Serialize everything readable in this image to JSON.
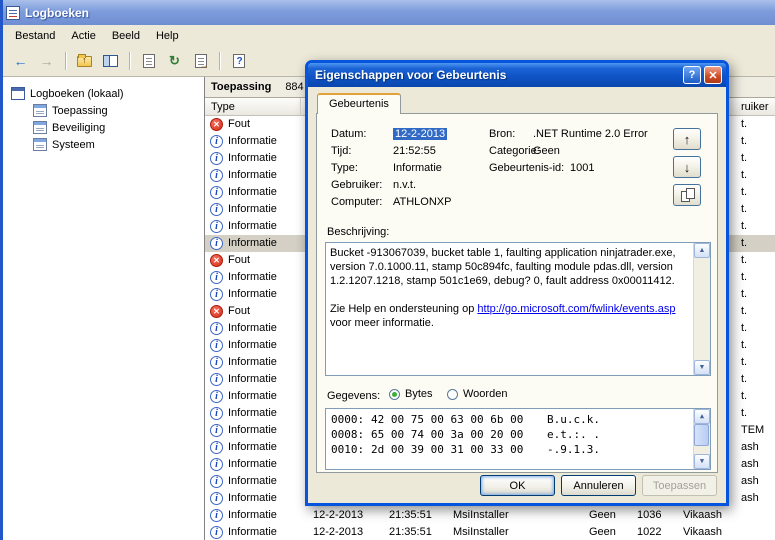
{
  "window": {
    "title": "Logboeken",
    "menus": [
      "Bestand",
      "Actie",
      "Beeld",
      "Help"
    ],
    "toolbar": [
      {
        "kind": "glyph",
        "name": "back",
        "glyph": "←",
        "cls": "c-blue"
      },
      {
        "kind": "glyph",
        "name": "forward",
        "glyph": "→",
        "cls": "c-gray"
      },
      {
        "kind": "sep"
      },
      {
        "kind": "shape",
        "name": "up-level"
      },
      {
        "kind": "shape",
        "name": "show-hide-tree"
      },
      {
        "kind": "sep"
      },
      {
        "kind": "shape",
        "name": "properties"
      },
      {
        "kind": "glyph",
        "name": "refresh",
        "glyph": "↻",
        "cls": "c-green"
      },
      {
        "kind": "shape",
        "name": "export-list"
      },
      {
        "kind": "sep"
      },
      {
        "kind": "shape",
        "name": "help"
      }
    ]
  },
  "tree": {
    "root": {
      "label": "Logboeken (lokaal)"
    },
    "items": [
      {
        "label": "Toepassing"
      },
      {
        "label": "Beveiliging"
      },
      {
        "label": "Systeem"
      }
    ]
  },
  "list": {
    "pane_title": "Toepassing",
    "pane_count": "884",
    "columns": {
      "type": "Type",
      "gebruiker_partial": "ruiker"
    },
    "icons": {
      "error_glyph": "✕",
      "info_glyph": "i"
    },
    "rows": [
      {
        "type": "Fout",
        "gebruiker_tail": "t."
      },
      {
        "type": "Informatie",
        "gebruiker_tail": "t."
      },
      {
        "type": "Informatie",
        "gebruiker_tail": "t."
      },
      {
        "type": "Informatie",
        "gebruiker_tail": "t."
      },
      {
        "type": "Informatie",
        "gebruiker_tail": "t."
      },
      {
        "type": "Informatie",
        "gebruiker_tail": "t."
      },
      {
        "type": "Informatie",
        "gebruiker_tail": "t."
      },
      {
        "type": "Informatie",
        "gebruiker_tail": "t.",
        "selected": true
      },
      {
        "type": "Fout",
        "gebruiker_tail": "t."
      },
      {
        "type": "Informatie",
        "gebruiker_tail": "t."
      },
      {
        "type": "Informatie",
        "gebruiker_tail": "t."
      },
      {
        "type": "Fout",
        "gebruiker_tail": "t."
      },
      {
        "type": "Informatie",
        "gebruiker_tail": "t."
      },
      {
        "type": "Informatie",
        "gebruiker_tail": "t."
      },
      {
        "type": "Informatie",
        "gebruiker_tail": "t."
      },
      {
        "type": "Informatie",
        "gebruiker_tail": "t."
      },
      {
        "type": "Informatie",
        "gebruiker_tail": "t."
      },
      {
        "type": "Informatie",
        "gebruiker_tail": "t."
      },
      {
        "type": "Informatie",
        "gebruiker_tail": "TEM"
      },
      {
        "type": "Informatie",
        "gebruiker_tail": "ash"
      },
      {
        "type": "Informatie",
        "gebruiker_tail": "ash"
      },
      {
        "type": "Informatie",
        "gebruiker_tail": "ash"
      },
      {
        "type": "Informatie",
        "gebruiker_tail": "ash"
      },
      {
        "type": "Informatie",
        "datum": "12-2-2013",
        "tijd": "21:35:51",
        "bron": "MsiInstaller",
        "categorie": "Geen",
        "id": "1036",
        "gebruiker": "Vikaash"
      },
      {
        "type": "Informatie",
        "datum": "12-2-2013",
        "tijd": "21:35:51",
        "bron": "MsiInstaller",
        "categorie": "Geen",
        "id": "1022",
        "gebruiker": "Vikaash"
      }
    ]
  },
  "dialog": {
    "title": "Eigenschappen voor Gebeurtenis",
    "tab": "Gebeurtenis",
    "icons": {
      "help": "?",
      "close": "✕",
      "up": "↑",
      "down": "↓",
      "scroll_up": "▲",
      "scroll_down": "▼"
    },
    "fields": {
      "datum_label": "Datum:",
      "datum": "12-2-2013",
      "tijd_label": "Tijd:",
      "tijd": "21:52:55",
      "type_label": "Type:",
      "type": "Informatie",
      "gebruiker_label": "Gebruiker:",
      "gebruiker": "n.v.t.",
      "computer_label": "Computer:",
      "computer": "ATHLONXP",
      "bron_label": "Bron:",
      "bron": ".NET Runtime 2.0 Error",
      "categorie_label": "Categorie:",
      "categorie": "Geen",
      "id_label": "Gebeurtenis-id:",
      "id": "1001"
    },
    "beschrijving_label": "Beschrijving:",
    "description": {
      "text": "Bucket -913067039, bucket table 1, faulting application ninjatrader.exe, version 7.0.1000.11, stamp 50c894fc, faulting module pdas.dll, version 1.2.1207.1218, stamp 501c1e69, debug? 0, fault address 0x00011412.",
      "help_prefix": "Zie Help en ondersteuning op ",
      "link": "http://go.microsoft.com/fwlink/events.asp",
      "help_suffix": " voor meer informatie."
    },
    "gegevens_label": "Gegevens:",
    "radio_bytes": "Bytes",
    "radio_woorden": "Woorden",
    "hex": [
      {
        "offset": "0000:",
        "bytes": "42 00 75 00 63 00 6b 00",
        "ascii": "B.u.c.k."
      },
      {
        "offset": "0008:",
        "bytes": "65 00 74 00 3a 00 20 00",
        "ascii": "e.t.:. ."
      },
      {
        "offset": "0010:",
        "bytes": "2d 00 39 00 31 00 33 00",
        "ascii": "-.9.1.3."
      }
    ],
    "buttons": {
      "ok": "OK",
      "annuleren": "Annuleren",
      "toepassen": "Toepassen"
    }
  }
}
